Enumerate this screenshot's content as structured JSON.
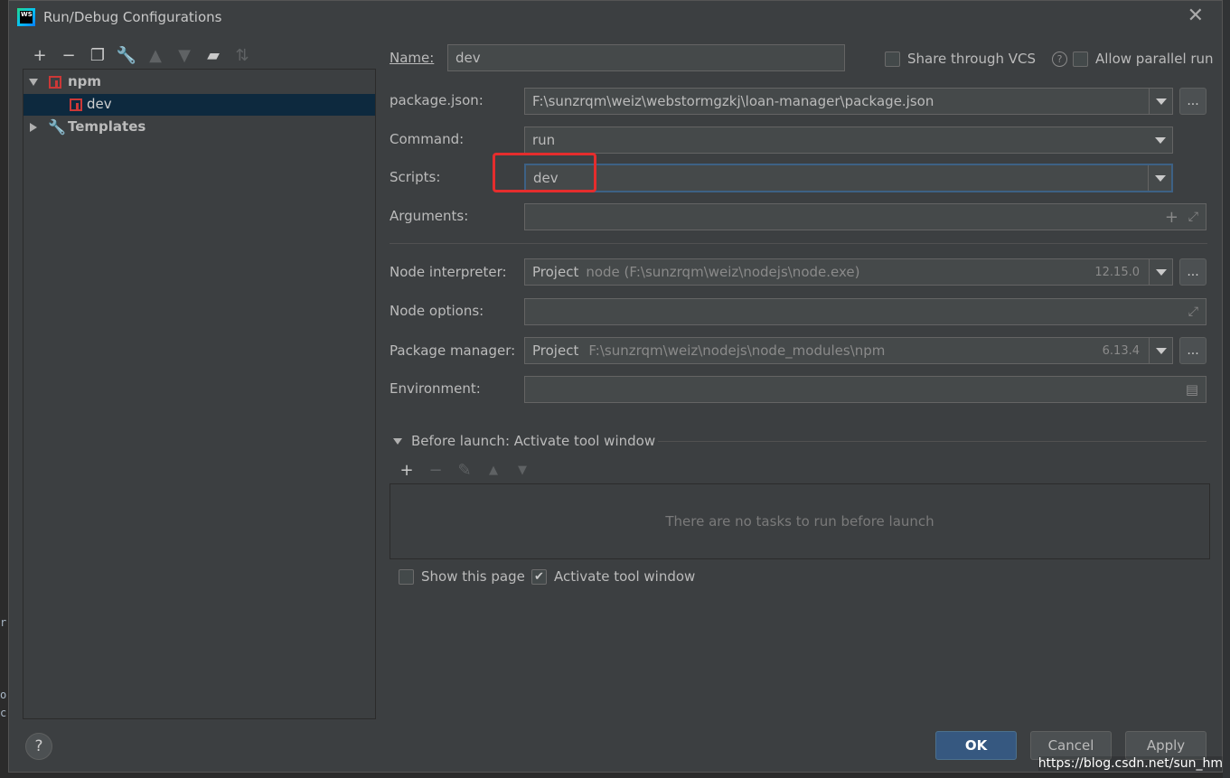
{
  "title": "Run/Debug Configurations",
  "tree": {
    "npm_label": "npm",
    "dev_label": "dev",
    "templates_label": "Templates"
  },
  "form": {
    "name_label": "Name:",
    "name_value": "dev",
    "share_vcs_label": "Share through VCS",
    "allow_parallel_label": "Allow parallel run",
    "package_json_label": "package.json:",
    "package_json_value": "F:\\sunzrqm\\weiz\\webstormgzkj\\loan-manager\\package.json",
    "command_label": "Command:",
    "command_value": "run",
    "scripts_label": "Scripts:",
    "scripts_value": "dev",
    "arguments_label": "Arguments:",
    "node_interpreter_label": "Node interpreter:",
    "node_interpreter_project": "Project",
    "node_interpreter_path": "node (F:\\sunzrqm\\weiz\\nodejs\\node.exe)",
    "node_interpreter_version": "12.15.0",
    "node_options_label": "Node options:",
    "package_manager_label": "Package manager:",
    "package_manager_project": "Project",
    "package_manager_path": "F:\\sunzrqm\\weiz\\nodejs\\node_modules\\npm",
    "package_manager_version": "6.13.4",
    "environment_label": "Environment:"
  },
  "before_launch": {
    "title": "Before launch: Activate tool window",
    "empty_text": "There are no tasks to run before launch",
    "show_page_label": "Show this page",
    "activate_label": "Activate tool window",
    "activate_checked": true
  },
  "buttons": {
    "ok": "OK",
    "cancel": "Cancel",
    "apply": "Apply"
  },
  "misc": {
    "ellipsis": "...",
    "help": "?",
    "watermark": "https://blog.csdn.net/sun_hm"
  },
  "colors": {
    "dialog_bg": "#3c3f41",
    "selection": "#0d293e",
    "primary_button": "#365880",
    "highlight_box": "#e52d2d",
    "npm_red": "#cb3837"
  }
}
